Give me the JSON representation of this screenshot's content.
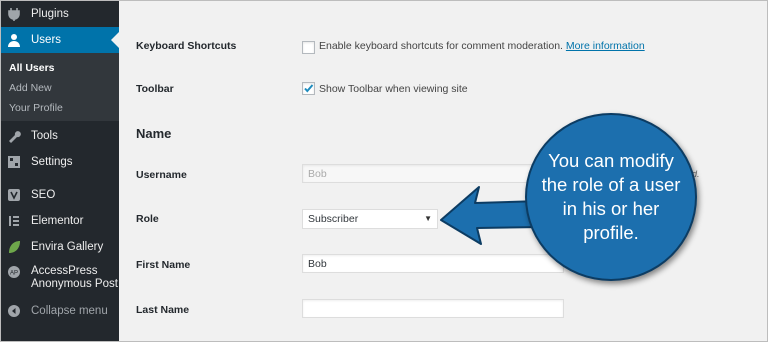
{
  "sidebar": {
    "items": [
      {
        "label": "Plugins",
        "icon": "plugin-icon"
      },
      {
        "label": "Users",
        "icon": "user-icon"
      },
      {
        "label": "Tools",
        "icon": "wrench-icon"
      },
      {
        "label": "Settings",
        "icon": "settings-icon"
      },
      {
        "label": "SEO",
        "icon": "seo-icon"
      },
      {
        "label": "Elementor",
        "icon": "elementor-icon"
      },
      {
        "label": "Envira Gallery",
        "icon": "leaf-icon"
      },
      {
        "label": "AccessPress Anonymous Post",
        "label_line1": "AccessPress",
        "label_line2": "Anonymous Post",
        "icon": "accesspress-icon"
      },
      {
        "label": "Collapse menu",
        "icon": "collapse-icon"
      }
    ],
    "submenu": [
      "All Users",
      "Add New",
      "Your Profile"
    ],
    "accent_color": "#0073aa",
    "background_color": "#23282d"
  },
  "form": {
    "keyboard_shortcuts": {
      "label": "Keyboard Shortcuts",
      "checkbox_text": "Enable keyboard shortcuts for comment moderation.",
      "link_text": "More information",
      "checked": false
    },
    "toolbar": {
      "label": "Toolbar",
      "checkbox_text": "Show Toolbar when viewing site",
      "checked": true
    },
    "name_heading": "Name",
    "username": {
      "label": "Username",
      "value": "Bob",
      "hint_fragment": "ed."
    },
    "role": {
      "label": "Role",
      "value": "Subscriber"
    },
    "first_name": {
      "label": "First Name",
      "value": "Bob"
    },
    "last_name": {
      "label": "Last Name",
      "value": ""
    }
  },
  "callout": {
    "text": "You can modify the role of a user in his or her profile.",
    "color": "#1c6fae"
  }
}
